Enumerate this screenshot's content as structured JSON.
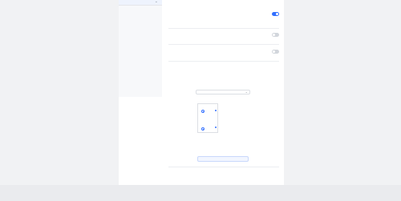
{
  "sidebar": {
    "header": "",
    "items": [
      {
        "label": "",
        "active": false
      },
      {
        "label": "",
        "active": false
      },
      {
        "label": "",
        "active": false
      },
      {
        "label": "",
        "active": false
      },
      {
        "label": "",
        "active": false
      },
      {
        "label": "",
        "active": false
      },
      {
        "label": "",
        "active": false
      },
      {
        "label": "",
        "active": false
      },
      {
        "label": "",
        "active": false
      },
      {
        "label": "",
        "active": true
      }
    ]
  },
  "settings": [
    {
      "title": "",
      "description": "",
      "enabled": true
    },
    {
      "title": "",
      "description": "",
      "enabled": false
    },
    {
      "title": "",
      "description": "",
      "enabled": false
    }
  ],
  "customize": {
    "title": "",
    "action_label": "",
    "description": "",
    "select_label": "",
    "select_value": "",
    "hint": "",
    "options": [
      "",
      ""
    ],
    "field_rows": [
      {
        "label": "",
        "value": ""
      },
      {
        "label": "",
        "value": ""
      }
    ],
    "submit_label": ""
  },
  "bottom": {
    "title": "",
    "action_label": "",
    "description": "",
    "sub_label": ""
  },
  "footer": {
    "links": [
      "",
      "",
      ""
    ],
    "copyright": [
      "",
      "",
      "",
      ""
    ]
  },
  "colors": {
    "accent": "#3370ff",
    "toggle_off": "#d2d6dc",
    "page_bg": "#f1f2f4"
  },
  "icons": [
    "chevron-down-icon",
    "toggle-switch",
    "radio-icon"
  ]
}
